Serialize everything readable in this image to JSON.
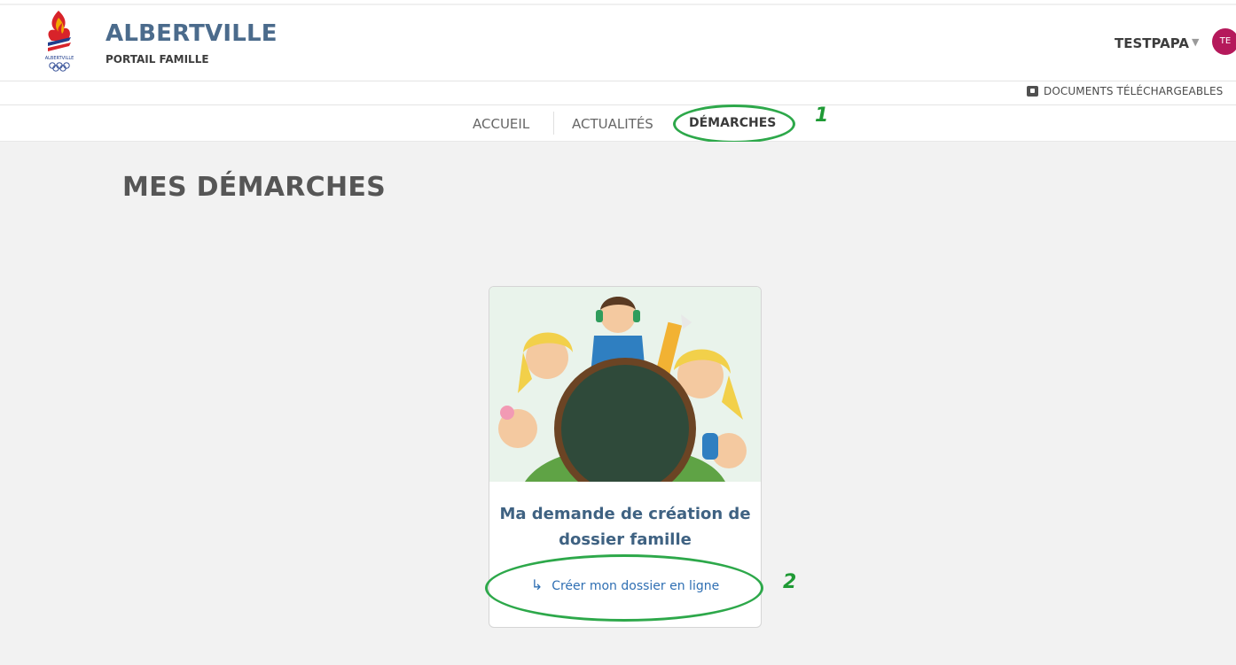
{
  "brand": {
    "title": "ALBERTVILLE",
    "subtitle": "PORTAIL FAMILLE",
    "logo_icon": "albertville-olympic-flame-logo"
  },
  "user": {
    "name": "TESTPAPA",
    "avatar_initials": "TE",
    "avatar_color": "#b5195b"
  },
  "toolbar": {
    "documents_label": "DOCUMENTS TÉLÉCHARGEABLES",
    "documents_icon": "download-box-icon"
  },
  "nav": {
    "items": [
      {
        "label": "ACCUEIL"
      },
      {
        "label": "ACTUALITÉS"
      },
      {
        "label": "DÉMARCHES",
        "active": true
      }
    ]
  },
  "annotations": {
    "marker1": "1",
    "marker2": "2",
    "color": "#2da84a"
  },
  "page": {
    "title": "MES DÉMARCHES"
  },
  "card": {
    "title": "Ma demande de création de dossier famille",
    "link_label": "Créer mon dossier en ligne",
    "link_arrow": "↳"
  },
  "colors": {
    "brand": "#4b6b8c",
    "link": "#2f6fb3",
    "background": "#f2f2f2"
  }
}
